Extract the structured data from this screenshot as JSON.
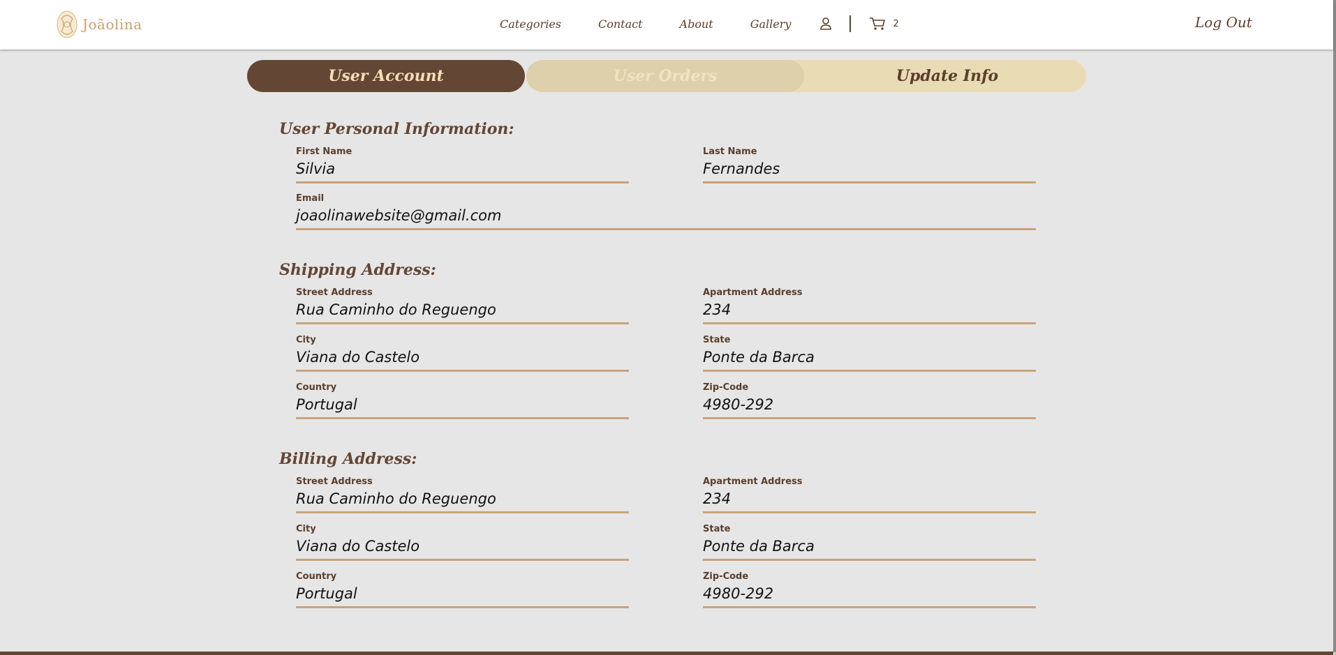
{
  "header": {
    "logo_text": "Joãolina",
    "nav": [
      "Categories",
      "Contact",
      "About",
      "Gallery"
    ],
    "user_icon": "user-icon",
    "cart_icon": "cart-icon",
    "cart_count": "2",
    "logout": "Log Out"
  },
  "tabs": {
    "account": "User Account",
    "orders": "User Orders",
    "update": "Update Info"
  },
  "personal": {
    "title": "User Personal Information:",
    "first_name": {
      "label": "First Name",
      "value": "Silvia"
    },
    "last_name": {
      "label": "Last Name",
      "value": "Fernandes"
    },
    "email": {
      "label": "Email",
      "value": "joaolinawebsite@gmail.com"
    }
  },
  "shipping": {
    "title": "Shipping Address:",
    "street": {
      "label": "Street Address",
      "value": "Rua Caminho do Reguengo"
    },
    "apartment": {
      "label": "Apartment Address",
      "value": "234"
    },
    "city": {
      "label": "City",
      "value": "Viana do Castelo"
    },
    "state": {
      "label": "State",
      "value": "Ponte da Barca"
    },
    "country": {
      "label": "Country",
      "value": "Portugal"
    },
    "zip": {
      "label": "Zip-Code",
      "value": "4980-292"
    }
  },
  "billing": {
    "title": "Billing Address:",
    "street": {
      "label": "Street Address",
      "value": "Rua Caminho do Reguengo"
    },
    "apartment": {
      "label": "Apartment Address",
      "value": "234"
    },
    "city": {
      "label": "City",
      "value": "Viana do Castelo"
    },
    "state": {
      "label": "State",
      "value": "Ponte da Barca"
    },
    "country": {
      "label": "Country",
      "value": "Portugal"
    },
    "zip": {
      "label": "Zip-Code",
      "value": "4980-292"
    }
  },
  "colors": {
    "brand_brown": "#634634",
    "accent_gold": "#c9a27a",
    "tab_light": "#e9dcb4",
    "background": "#e6e6e6"
  }
}
